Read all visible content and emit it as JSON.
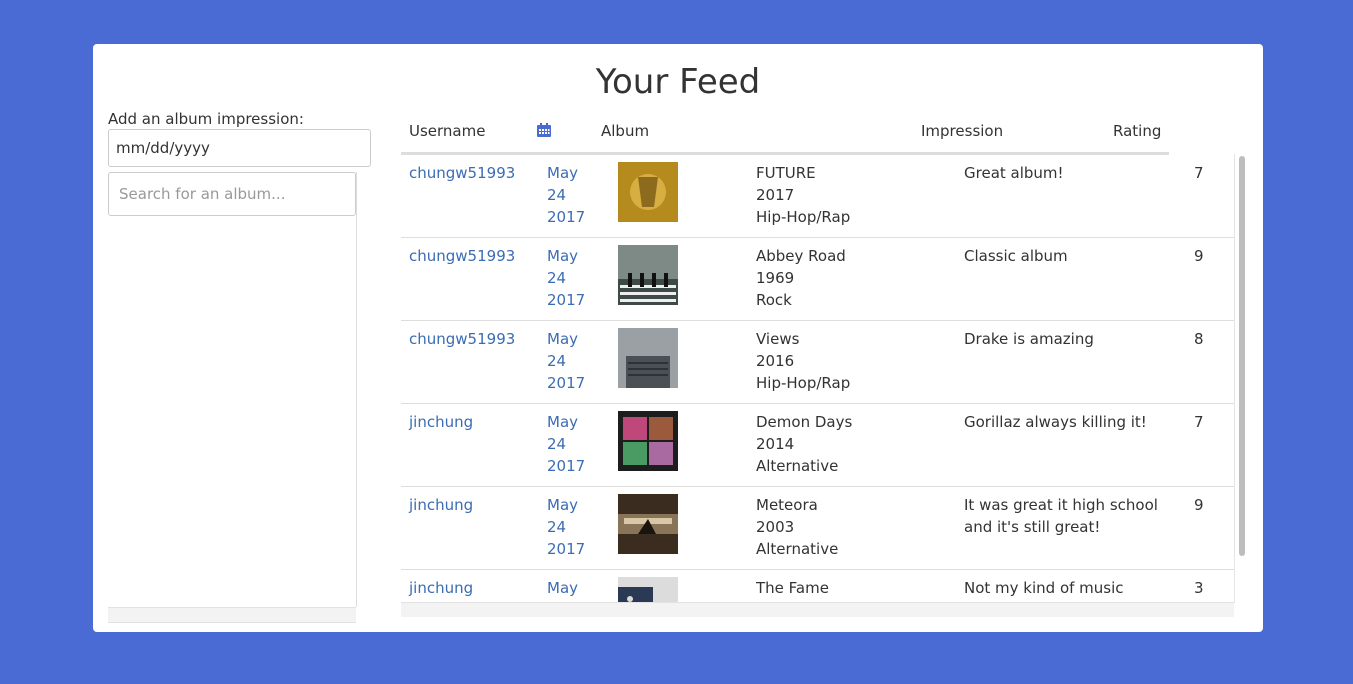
{
  "page": {
    "title": "Your Feed"
  },
  "form": {
    "label": "Add an album impression:",
    "date_placeholder": "mm/dd/yyyy",
    "search_placeholder": "Search for an album..."
  },
  "table": {
    "headers": {
      "username": "Username",
      "album": "Album",
      "impression": "Impression",
      "rating": "Rating"
    },
    "rows": [
      {
        "username": "chungw51993",
        "date": [
          "May",
          "24",
          "2017"
        ],
        "album": "FUTURE",
        "year": "2017",
        "genre": "Hip-Hop/Rap",
        "impression": "Great album!",
        "rating": "7",
        "cover_colors": [
          "#b58b1e",
          "#e0b64a"
        ]
      },
      {
        "username": "chungw51993",
        "date": [
          "May",
          "24",
          "2017"
        ],
        "album": "Abbey Road",
        "year": "1969",
        "genre": "Rock",
        "impression": "Classic album",
        "rating": "9",
        "cover_colors": [
          "#7d8a86",
          "#3d4a48"
        ]
      },
      {
        "username": "chungw51993",
        "date": [
          "May",
          "24",
          "2017"
        ],
        "album": "Views",
        "year": "2016",
        "genre": "Hip-Hop/Rap",
        "impression": "Drake is amazing",
        "rating": "8",
        "cover_colors": [
          "#9aa0a4",
          "#4a5055"
        ]
      },
      {
        "username": "jinchung",
        "date": [
          "May",
          "24",
          "2017"
        ],
        "album": "Demon Days",
        "year": "2014",
        "genre": "Alternative",
        "impression": "Gorillaz always killing it!",
        "rating": "7",
        "cover_colors": [
          "#1d1d1d",
          "#c0477a"
        ]
      },
      {
        "username": "jinchung",
        "date": [
          "May",
          "24",
          "2017"
        ],
        "album": "Meteora",
        "year": "2003",
        "genre": "Alternative",
        "impression": "It was great it high school and it's still great!",
        "rating": "9",
        "cover_colors": [
          "#3a2d20",
          "#8a7458"
        ]
      },
      {
        "username": "jinchung",
        "date": [
          "May"
        ],
        "album": "The Fame",
        "year": "",
        "genre": "",
        "impression": "Not my kind of music",
        "rating": "3",
        "cover_colors": [
          "#2a3a55",
          "#dcdcdc"
        ]
      }
    ]
  },
  "colors": {
    "background": "#4a6bd3",
    "link": "#3b6cb4",
    "calendar_icon": "#4a6bd3"
  },
  "icons": {
    "calendar": "calendar-icon"
  }
}
